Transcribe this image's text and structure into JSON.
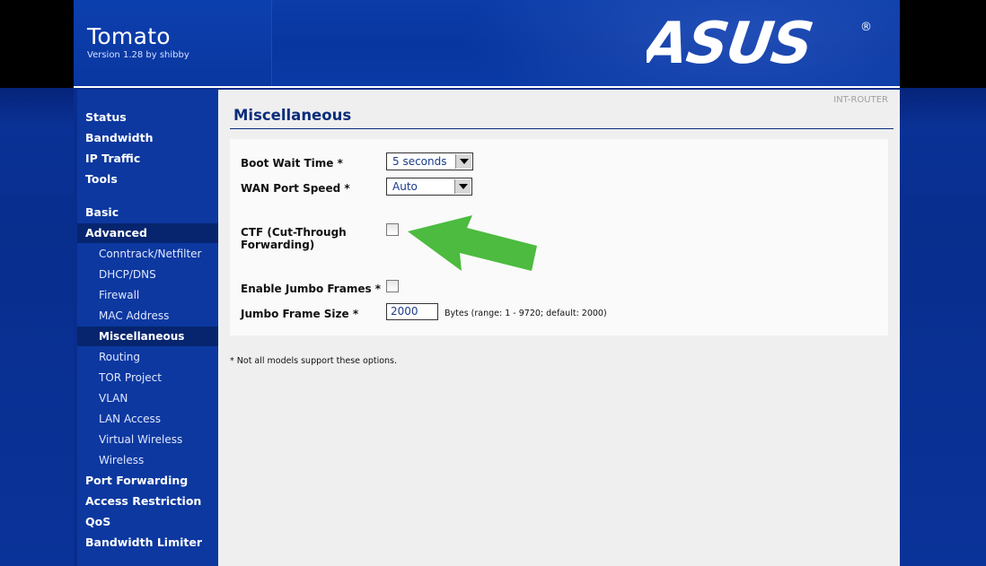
{
  "header": {
    "title": "Tomato",
    "version": "Version 1.28 by shibby",
    "brand": "ASUS",
    "brand_color": "#ffffff"
  },
  "router_name": "INT-ROUTER",
  "sidebar": {
    "items": [
      {
        "label": "Status"
      },
      {
        "label": "Bandwidth"
      },
      {
        "label": "IP Traffic"
      },
      {
        "label": "Tools"
      },
      {
        "label": "Basic"
      },
      {
        "label": "Advanced"
      },
      {
        "label": "Conntrack/Netfilter"
      },
      {
        "label": "DHCP/DNS"
      },
      {
        "label": "Firewall"
      },
      {
        "label": "MAC Address"
      },
      {
        "label": "Miscellaneous"
      },
      {
        "label": "Routing"
      },
      {
        "label": "TOR Project"
      },
      {
        "label": "VLAN"
      },
      {
        "label": "LAN Access"
      },
      {
        "label": "Virtual Wireless"
      },
      {
        "label": "Wireless"
      },
      {
        "label": "Port Forwarding"
      },
      {
        "label": "Access Restriction"
      },
      {
        "label": "QoS"
      },
      {
        "label": "Bandwidth Limiter"
      }
    ],
    "active_section": "Advanced",
    "active_page": "Miscellaneous"
  },
  "page": {
    "title": "Miscellaneous",
    "fields": {
      "boot_wait": {
        "label": "Boot Wait Time *",
        "value": "5 seconds"
      },
      "wan_speed": {
        "label": "WAN Port Speed *",
        "value": "Auto"
      },
      "ctf": {
        "label_line1": "CTF (Cut-Through",
        "label_line2": "Forwarding)",
        "checked": false
      },
      "jumbo_enable": {
        "label": "Enable Jumbo Frames *",
        "checked": false
      },
      "jumbo_size": {
        "label": "Jumbo Frame Size *",
        "value": "2000",
        "hint": "Bytes (range: 1 - 9720; default: 2000)"
      }
    },
    "footnote": "* Not all models support these options."
  },
  "annotation": {
    "arrow_color": "#4cbb3f"
  }
}
